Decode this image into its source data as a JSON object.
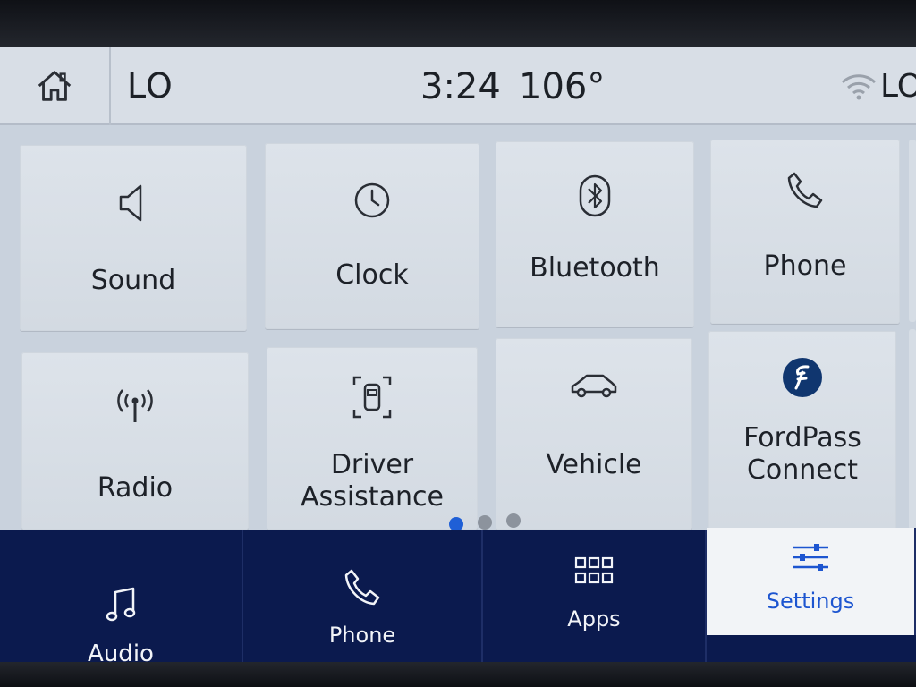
{
  "status_bar": {
    "home_icon": "home-icon",
    "temp_left": "LO",
    "time": "3:24",
    "outside_temp": "106°",
    "wifi_icon": "wifi-icon",
    "temp_right": "LO"
  },
  "tiles": [
    {
      "label": "Sound",
      "icon": "speaker-icon"
    },
    {
      "label": "Clock",
      "icon": "clock-icon"
    },
    {
      "label": "Bluetooth",
      "icon": "bluetooth-icon"
    },
    {
      "label": "Phone",
      "icon": "phone-icon"
    },
    {
      "label": "Radio",
      "icon": "radio-antenna-icon"
    },
    {
      "label_line1": "Driver",
      "label_line2": "Assistance",
      "icon": "driver-assist-icon"
    },
    {
      "label": "Vehicle",
      "icon": "car-icon"
    },
    {
      "label_line1": "FordPass",
      "label_line2": "Connect",
      "icon": "fordpass-logo-icon"
    }
  ],
  "pagination": {
    "pages": 3,
    "current": 1
  },
  "nav": [
    {
      "label": "Audio",
      "icon": "music-note-icon"
    },
    {
      "label": "Phone",
      "icon": "phone-icon"
    },
    {
      "label": "Apps",
      "icon": "apps-grid-icon"
    },
    {
      "label": "Settings",
      "icon": "settings-sliders-icon",
      "active": true
    }
  ],
  "colors": {
    "nav_bg": "#0b1a4e",
    "accent": "#1d55d0",
    "screen_bg": "#c9d2dd"
  }
}
